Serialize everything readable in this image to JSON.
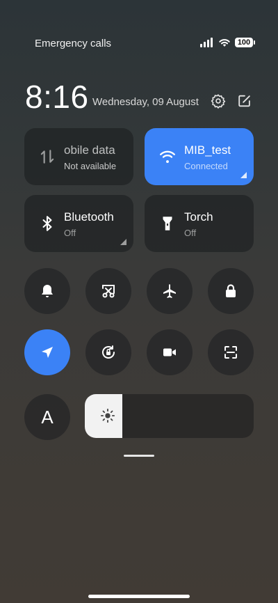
{
  "status_bar": {
    "left_text": "Emergency calls",
    "battery": "100"
  },
  "header": {
    "time": "8:16",
    "date": "Wednesday, 09 August"
  },
  "tiles": {
    "mobile_data": {
      "name": "Mobile data",
      "name_visible": "obile data",
      "status": "Not available"
    },
    "wifi": {
      "name": "MIB_test",
      "status": "Connected"
    },
    "bluetooth": {
      "name": "Bluetooth",
      "status": "Off"
    },
    "torch": {
      "name": "Torch",
      "status": "Off"
    }
  },
  "toggles": {
    "auto_brightness_letter": "A"
  },
  "brightness": {
    "level_percent": 22
  },
  "colors": {
    "accent": "#3b82f6",
    "tile_bg": "#1c1e20"
  },
  "icons": [
    "gear-icon",
    "edit-icon",
    "data-arrows-icon",
    "wifi-icon",
    "bluetooth-icon",
    "torch-icon",
    "bell-icon",
    "screenshot-icon",
    "airplane-icon",
    "lock-icon",
    "location-icon",
    "rotation-lock-icon",
    "video-icon",
    "scanner-icon",
    "sun-icon"
  ]
}
